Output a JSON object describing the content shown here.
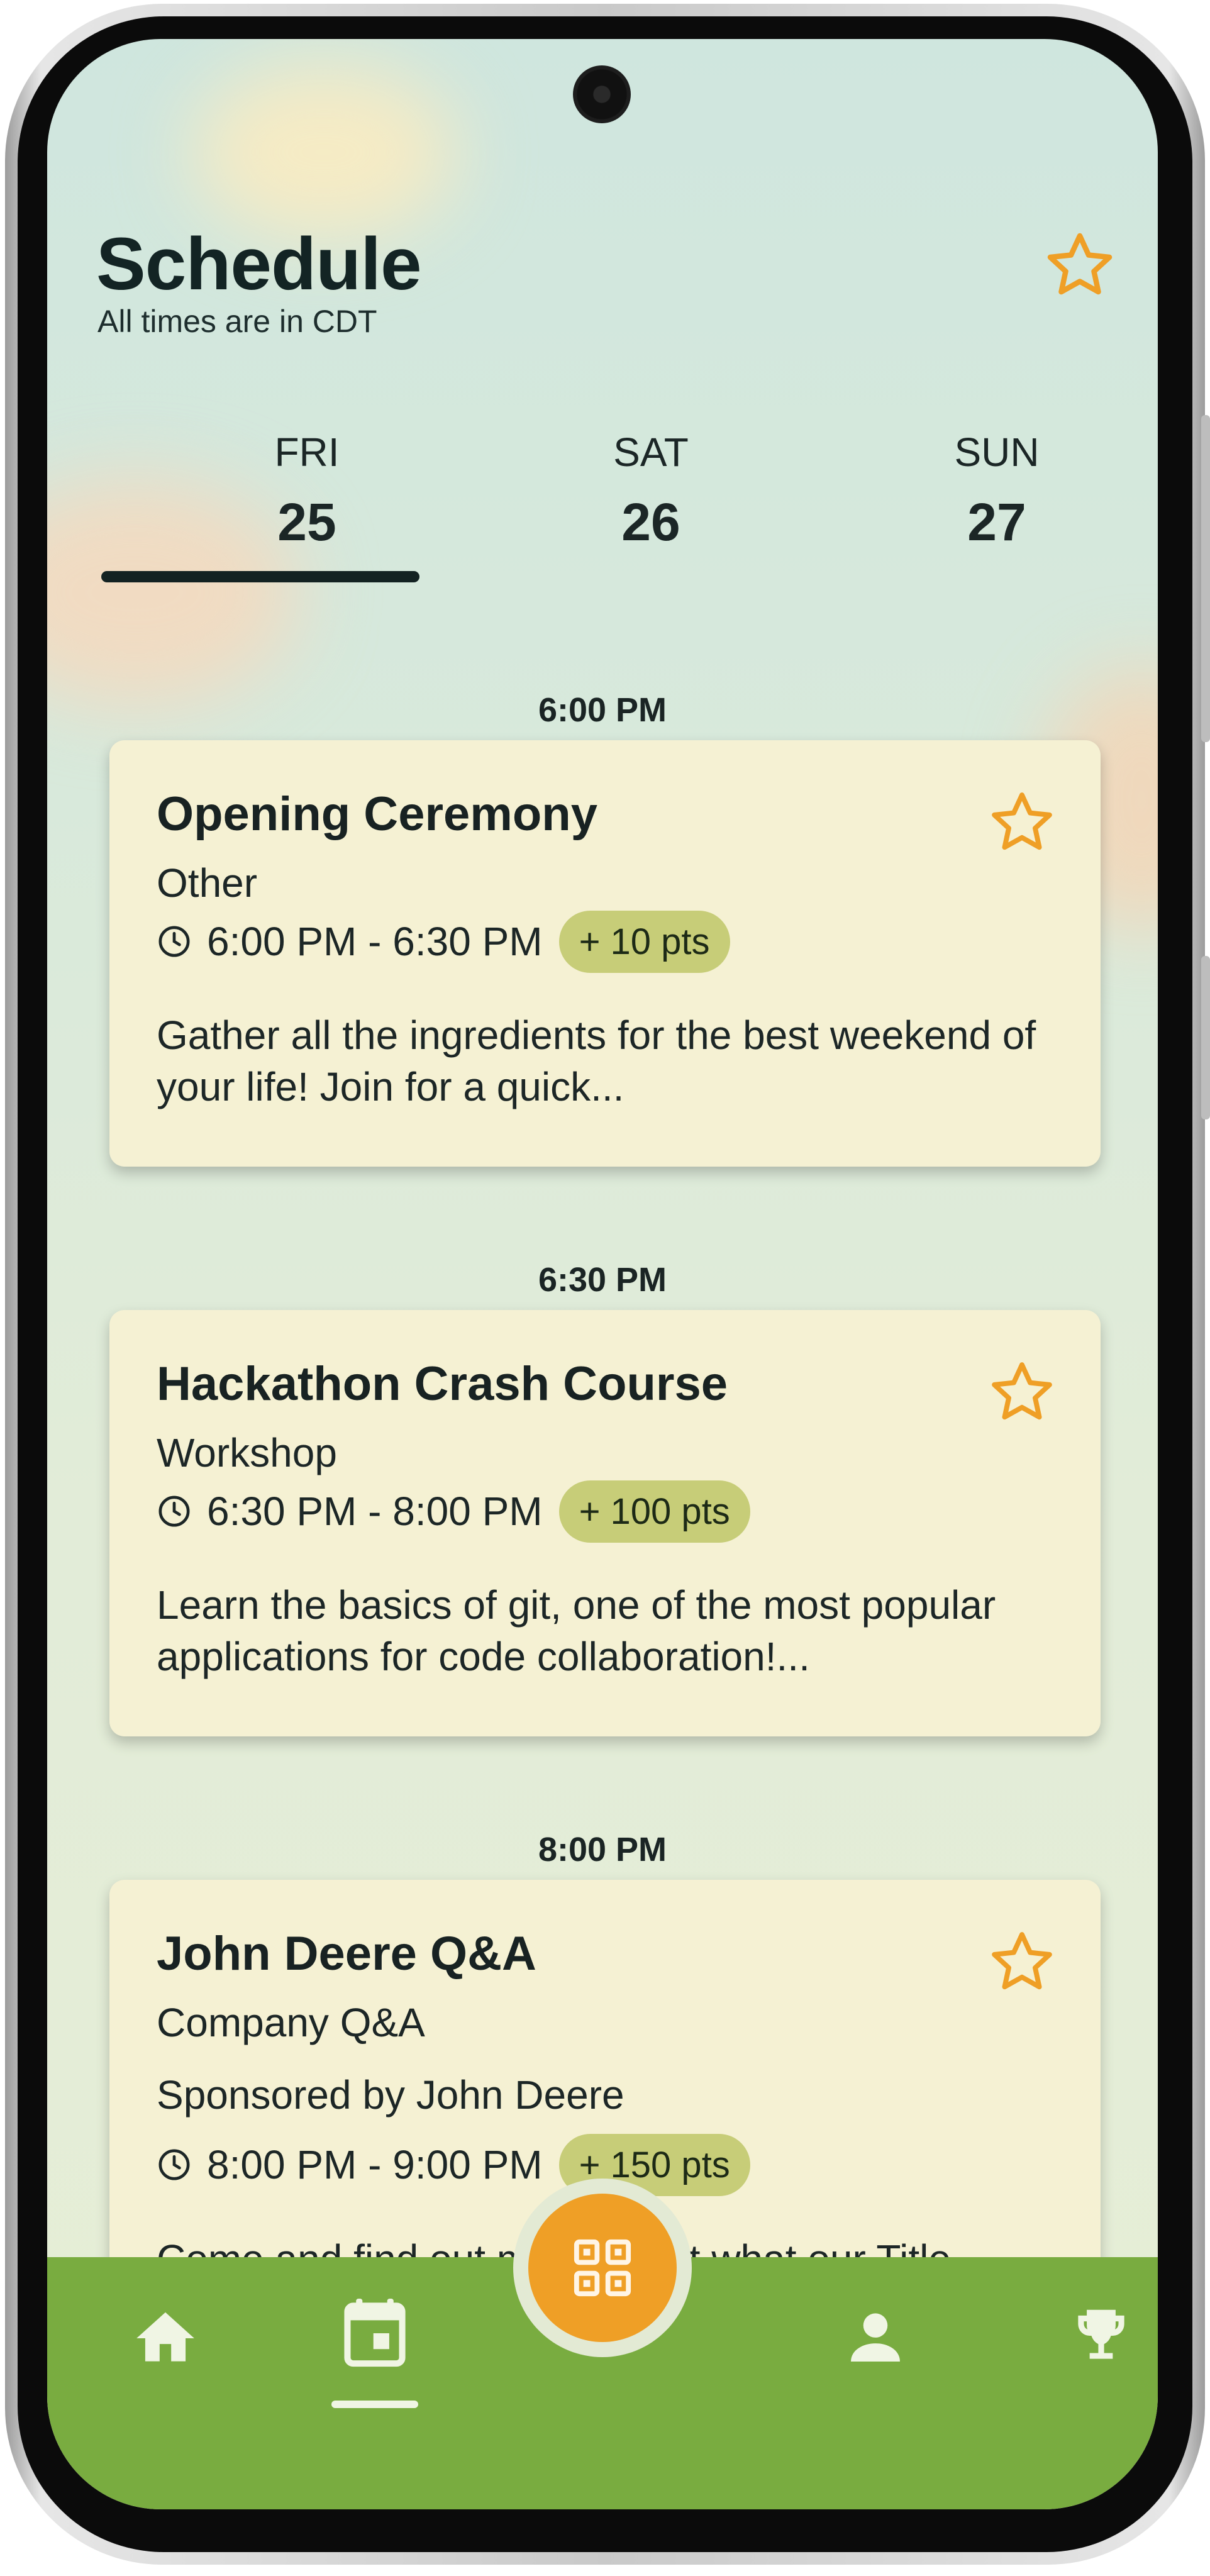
{
  "header": {
    "title": "Schedule",
    "subtitle": "All times are in CDT"
  },
  "days": [
    {
      "name": "FRI",
      "date": "25",
      "selected": true
    },
    {
      "name": "SAT",
      "date": "26",
      "selected": false
    },
    {
      "name": "SUN",
      "date": "27",
      "selected": false
    }
  ],
  "time_slots": [
    "6:00 PM",
    "6:30 PM",
    "8:00 PM"
  ],
  "events": [
    {
      "title": "Opening Ceremony",
      "category": "Other",
      "time": "6:00 PM - 6:30 PM",
      "points": "+ 10 pts",
      "description": "Gather all the ingredients for the best weekend of your life! Join for a quick..."
    },
    {
      "title": "Hackathon Crash Course",
      "category": "Workshop",
      "time": "6:30 PM - 8:00 PM",
      "points": "+ 100 pts",
      "description": "Learn the basics of git, one of the most popular applications for code collaboration!..."
    },
    {
      "title": "John Deere Q&A",
      "category": "Company Q&A",
      "sponsor": "Sponsored by John Deere",
      "time": "8:00 PM - 9:00 PM",
      "points": "+ 150 pts",
      "description": "Come and find out more about what our Title sponsors!"
    }
  ],
  "nav": {
    "items": [
      "home-icon",
      "calendar-icon",
      "qr-code-icon",
      "profile-icon",
      "trophy-icon"
    ],
    "active": "calendar-icon"
  },
  "colors": {
    "accent_orange": "#ef9f26",
    "nav_green": "#79ac40",
    "card_bg": "#f5f1d3",
    "points_badge": "#c7cd78"
  }
}
